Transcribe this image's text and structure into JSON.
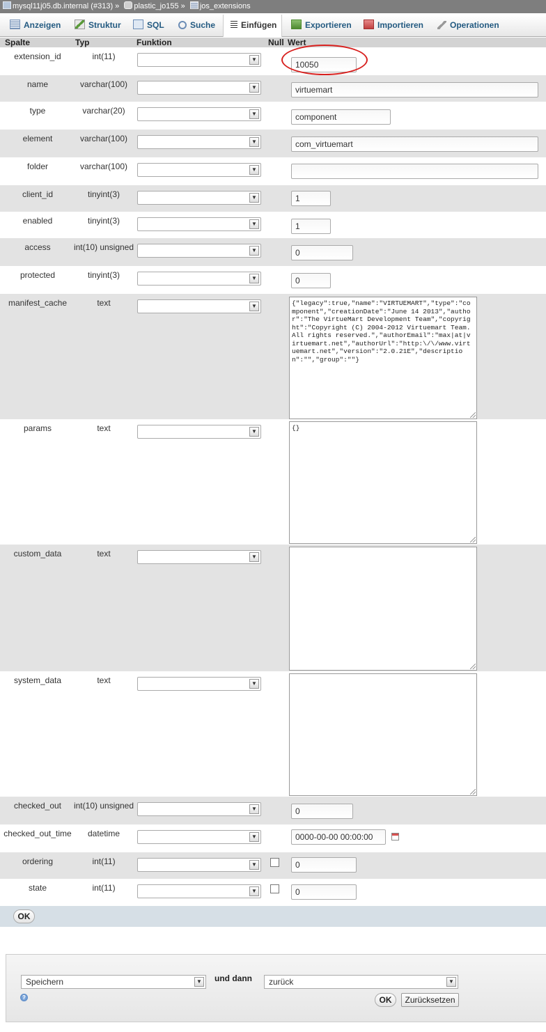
{
  "breadcrumb": {
    "server": "mysql11j05.db.internal (#313)",
    "sep1": "»",
    "database": "plastic_jo155",
    "sep2": "»",
    "table": "jos_extensions"
  },
  "tabs": [
    {
      "label": "Anzeigen",
      "icon": "browse-icon",
      "active": false
    },
    {
      "label": "Struktur",
      "icon": "structure-icon",
      "active": false
    },
    {
      "label": "SQL",
      "icon": "sql-icon",
      "active": false
    },
    {
      "label": "Suche",
      "icon": "search-icon",
      "active": false
    },
    {
      "label": "Einfügen",
      "icon": "insert-icon",
      "active": true
    },
    {
      "label": "Exportieren",
      "icon": "export-icon",
      "active": false
    },
    {
      "label": "Importieren",
      "icon": "import-icon",
      "active": false
    },
    {
      "label": "Operationen",
      "icon": "wrench-icon",
      "active": false
    }
  ],
  "header": {
    "spalte": "Spalte",
    "typ": "Typ",
    "funktion": "Funktion",
    "null": "Null",
    "wert": "Wert"
  },
  "rows": [
    {
      "name": "extension_id",
      "type": "int(11)",
      "value": "10050"
    },
    {
      "name": "name",
      "type": "varchar(100)",
      "value": "virtuemart"
    },
    {
      "name": "type",
      "type": "varchar(20)",
      "value": "component"
    },
    {
      "name": "element",
      "type": "varchar(100)",
      "value": "com_virtuemart"
    },
    {
      "name": "folder",
      "type": "varchar(100)",
      "value": ""
    },
    {
      "name": "client_id",
      "type": "tinyint(3)",
      "value": "1"
    },
    {
      "name": "enabled",
      "type": "tinyint(3)",
      "value": "1"
    },
    {
      "name": "access",
      "type": "int(10) unsigned",
      "value": "0"
    },
    {
      "name": "protected",
      "type": "tinyint(3)",
      "value": "0"
    },
    {
      "name": "manifest_cache",
      "type": "text",
      "value": "{\"legacy\":true,\"name\":\"VIRTUEMART\",\"type\":\"component\",\"creationDate\":\"June 14 2013\",\"author\":\"The VirtueMart Development Team\",\"copyright\":\"Copyright (C) 2004-2012 Virtuemart Team. All rights reserved.\",\"authorEmail\":\"max|at|virtuemart.net\",\"authorUrl\":\"http:\\/\\/www.virtuemart.net\",\"version\":\"2.0.21E\",\"description\":\"\",\"group\":\"\"}"
    },
    {
      "name": "params",
      "type": "text",
      "value": "{}"
    },
    {
      "name": "custom_data",
      "type": "text",
      "value": ""
    },
    {
      "name": "system_data",
      "type": "text",
      "value": ""
    },
    {
      "name": "checked_out",
      "type": "int(10) unsigned",
      "value": "0"
    },
    {
      "name": "checked_out_time",
      "type": "datetime",
      "value": "0000-00-00 00:00:00"
    },
    {
      "name": "ordering",
      "type": "int(11)",
      "value": "0"
    },
    {
      "name": "state",
      "type": "int(11)",
      "value": "0"
    }
  ],
  "ok_label": "OK",
  "footer": {
    "action_select": "Speichern",
    "und_dann": "und dann",
    "after_select": "zurück",
    "ok_label": "OK",
    "reset_label": "Zurücksetzen"
  },
  "colors": {
    "highlight_circle": "#d8211f",
    "alt_row": "#e3e3e3",
    "tab_link": "#235a81"
  }
}
